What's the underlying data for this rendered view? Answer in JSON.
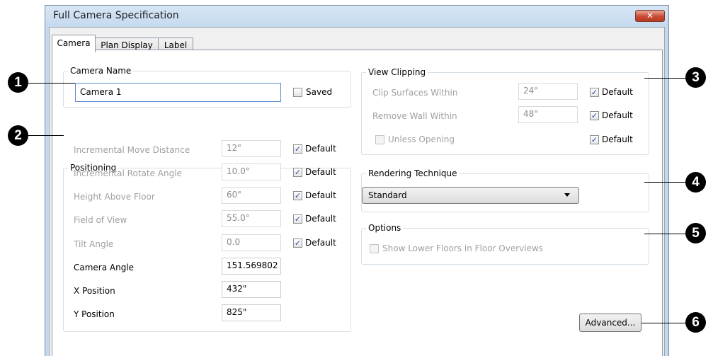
{
  "window": {
    "title": "Full Camera Specification",
    "close_glyph": "✕"
  },
  "tabs": [
    "Camera",
    "Plan Display",
    "Label"
  ],
  "camera_name": {
    "group": "Camera Name",
    "value": "Camera 1",
    "saved_label": "Saved",
    "saved_checked": false
  },
  "positioning": {
    "group": "Positioning",
    "default_label": "Default",
    "rows": [
      {
        "label": "Incremental Move Distance",
        "value": "12\"",
        "default": true,
        "enabled": false
      },
      {
        "label": "Incremental Rotate Angle",
        "value": "10.0°",
        "default": true,
        "enabled": false
      },
      {
        "label": "Height Above Floor",
        "value": "60\"",
        "default": true,
        "enabled": false
      },
      {
        "label": "Field of View",
        "value": "55.0°",
        "default": true,
        "enabled": false
      },
      {
        "label": "Tilt Angle",
        "value": "0.0",
        "default": true,
        "enabled": false
      },
      {
        "label": "Camera Angle",
        "value": "151.569802",
        "enabled": true
      },
      {
        "label": "X Position",
        "value": "432\"",
        "enabled": true
      },
      {
        "label": "Y Position",
        "value": "825\"",
        "enabled": true
      }
    ]
  },
  "view_clipping": {
    "group": "View Clipping",
    "default_label": "Default",
    "clip_surfaces": {
      "label": "Clip Surfaces Within",
      "value": "24\"",
      "default": true
    },
    "remove_wall": {
      "label": "Remove Wall Within",
      "value": "48\"",
      "default": true
    },
    "unless_opening": {
      "label": "Unless Opening",
      "checked": false,
      "default": true
    }
  },
  "rendering": {
    "group": "Rendering Technique",
    "selected": "Standard"
  },
  "options": {
    "group": "Options",
    "show_lower_floors": {
      "label": "Show Lower Floors in Floor Overviews",
      "checked": false
    }
  },
  "advanced_button": "Advanced...",
  "callouts": [
    "1",
    "2",
    "3",
    "4",
    "5",
    "6"
  ],
  "check_glyph": "✓"
}
